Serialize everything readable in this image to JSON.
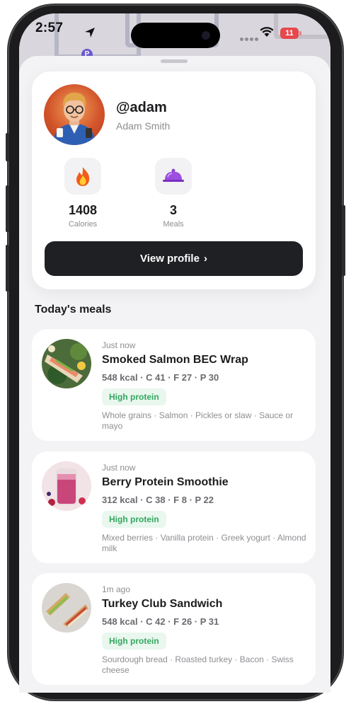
{
  "status_bar": {
    "time": "2:57",
    "battery": "11"
  },
  "profile": {
    "handle": "@adam",
    "name": "Adam Smith",
    "stats": [
      {
        "value": "1408",
        "label": "Calories",
        "icon": "flame-icon"
      },
      {
        "value": "3",
        "label": "Meals",
        "icon": "cloche-icon"
      }
    ],
    "view_profile_label": "View profile"
  },
  "section_title": "Today's meals",
  "meals": [
    {
      "time": "Just now",
      "name": "Smoked Salmon BEC Wrap",
      "macros": "548 kcal · C 41 · F 27 · P 30",
      "badge": "High protein",
      "ingredients": "Whole grains · Salmon · Pickles or slaw · Sauce or mayo"
    },
    {
      "time": "Just now",
      "name": "Berry Protein Smoothie",
      "macros": "312 kcal · C 38 · F 8 · P 22",
      "badge": "High protein",
      "ingredients": "Mixed berries · Vanilla protein · Greek yogurt · Almond milk"
    },
    {
      "time": "1m ago",
      "name": "Turkey Club Sandwich",
      "macros": "548 kcal · C 42 · F 26 · P 31",
      "badge": "High protein",
      "ingredients": "Sourdough bread · Roasted turkey · Bacon · Swiss cheese"
    }
  ],
  "colors": {
    "accent_dark": "#1f2024",
    "badge_green": "#34a760",
    "badge_bg": "#e9f7ee",
    "battery_red": "#e5484d"
  }
}
